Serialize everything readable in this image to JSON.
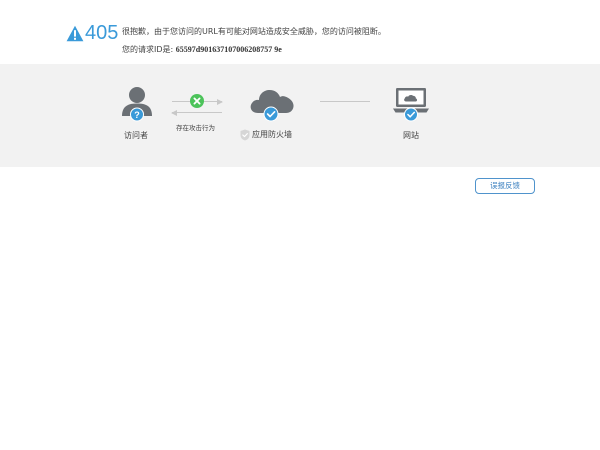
{
  "error": {
    "code": "405",
    "message": "很抱歉，由于您访问的URL有可能对网站造成安全威胁，您的访问被阻断。",
    "request_id_label": "您的请求ID是:",
    "request_id": "65597d901637107006208757 9e"
  },
  "flow": {
    "visitor_label": "访问者",
    "attack_label": "存在攻击行为",
    "firewall_label": "应用防火墙",
    "website_label": "网站"
  },
  "actions": {
    "feedback_label": "误报反馈"
  },
  "colors": {
    "accent": "#3a9ad9",
    "icon_gray": "#6b7075",
    "success_green": "#4cc35a",
    "band_bg": "#f2f2f2"
  }
}
